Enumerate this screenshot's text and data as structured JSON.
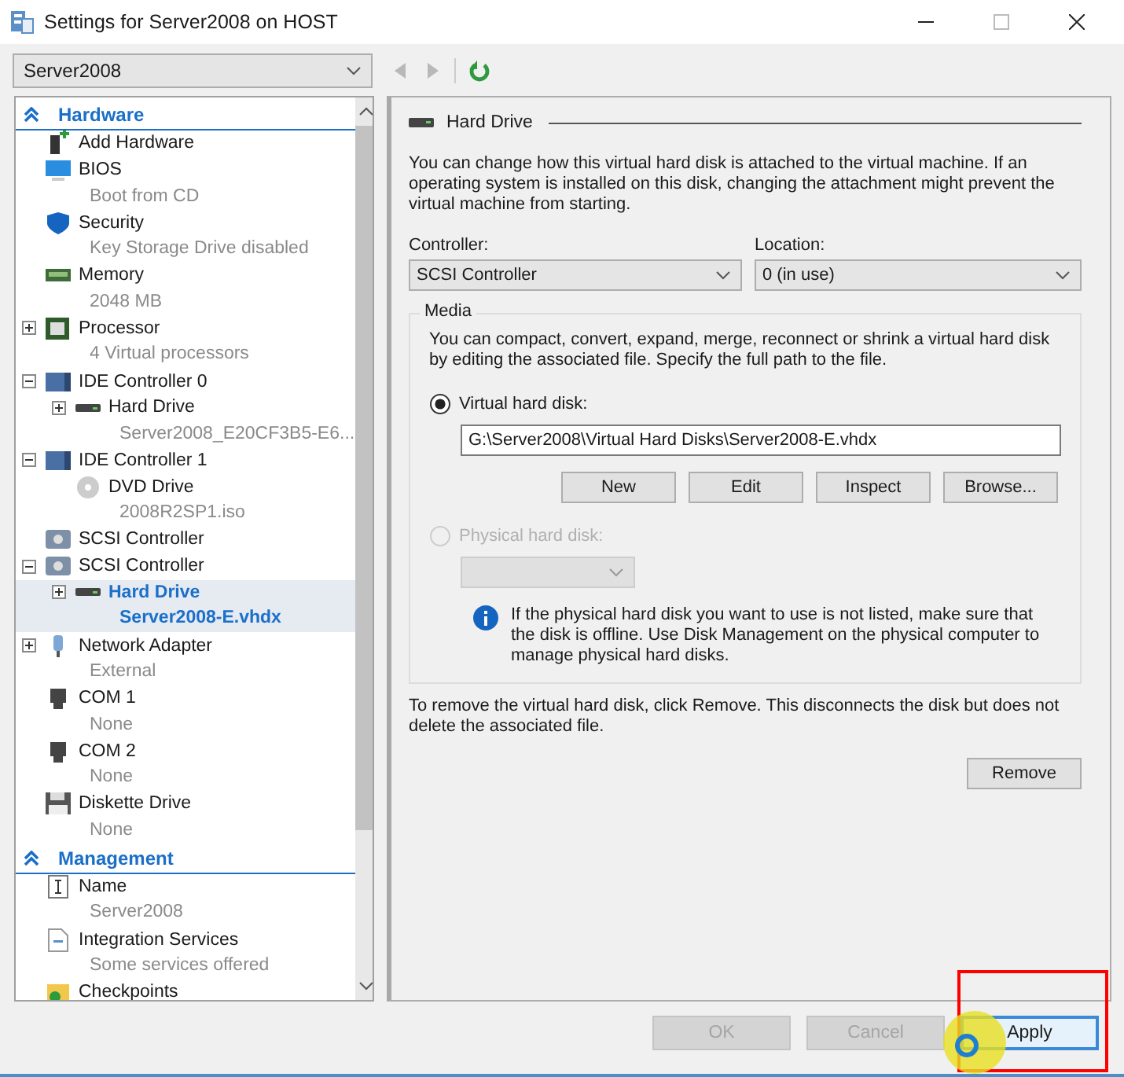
{
  "window": {
    "title": "Settings for Server2008 on HOST"
  },
  "vm_selector": {
    "value": "Server2008"
  },
  "sections": [
    {
      "title": "Hardware",
      "expanded": true,
      "items": [
        {
          "kind": "add-hardware",
          "label": "Add Hardware",
          "selected": false
        },
        {
          "kind": "bios",
          "label": "BIOS",
          "detail": "Boot from CD",
          "selected": false
        },
        {
          "kind": "security",
          "label": "Security",
          "detail": "Key Storage Drive disabled",
          "selected": false
        },
        {
          "kind": "memory",
          "label": "Memory",
          "detail": "2048 MB",
          "selected": false
        },
        {
          "kind": "processor",
          "label": "Processor",
          "detail": "4 Virtual processors",
          "selected": false,
          "expanded": false
        },
        {
          "kind": "ide",
          "label": "IDE Controller 0",
          "selected": false,
          "expanded": true,
          "children": [
            {
              "kind": "hard-drive",
              "label": "Hard Drive",
              "detail": "Server2008_E20CF3B5-E6...",
              "selected": false,
              "expanded": false
            }
          ]
        },
        {
          "kind": "ide",
          "label": "IDE Controller 1",
          "selected": false,
          "expanded": true,
          "children": [
            {
              "kind": "dvd",
              "label": "DVD Drive",
              "detail": "2008R2SP1.iso",
              "selected": false
            }
          ]
        },
        {
          "kind": "scsi",
          "label": "SCSI Controller",
          "selected": false
        },
        {
          "kind": "scsi",
          "label": "SCSI Controller",
          "selected": false,
          "expanded": true,
          "children": [
            {
              "kind": "hard-drive",
              "label": "Hard Drive",
              "detail": "Server2008-E.vhdx",
              "selected": true,
              "expanded": false
            }
          ]
        },
        {
          "kind": "network",
          "label": "Network Adapter",
          "detail": "External",
          "selected": false,
          "expanded": false
        },
        {
          "kind": "com",
          "label": "COM 1",
          "detail": "None",
          "selected": false
        },
        {
          "kind": "com",
          "label": "COM 2",
          "detail": "None",
          "selected": false
        },
        {
          "kind": "diskette",
          "label": "Diskette Drive",
          "detail": "None",
          "selected": false
        }
      ]
    },
    {
      "title": "Management",
      "expanded": true,
      "items": [
        {
          "kind": "name",
          "label": "Name",
          "detail": "Server2008",
          "selected": false
        },
        {
          "kind": "integration",
          "label": "Integration Services",
          "detail": "Some services offered",
          "selected": false
        },
        {
          "kind": "checkpoints",
          "label": "Checkpoints",
          "selected": false
        }
      ]
    }
  ],
  "details": {
    "title": "Hard Drive",
    "intro": "You can change how this virtual hard disk is attached to the virtual machine. If an operating system is installed on this disk, changing the attachment might prevent the virtual machine from starting.",
    "controller": {
      "label": "Controller:",
      "value": "SCSI Controller"
    },
    "location": {
      "label": "Location:",
      "value": "0 (in use)"
    },
    "media": {
      "title": "Media",
      "text": "You can compact, convert, expand, merge, reconnect or shrink a virtual hard disk by editing the associated file. Specify the full path to the file.",
      "options": [
        {
          "kind": "virtual",
          "label": "Virtual hard disk:",
          "selected": true,
          "disabled": false,
          "path": "G:\\Server2008\\Virtual Hard Disks\\Server2008-E.vhdx",
          "buttons": [
            "New",
            "Edit",
            "Inspect",
            "Browse..."
          ]
        },
        {
          "kind": "physical",
          "label": "Physical hard disk:",
          "selected": false,
          "disabled": true,
          "info": "If the physical hard disk you want to use is not listed, make sure that the disk is offline. Use Disk Management on the physical computer to manage physical hard disks."
        }
      ]
    },
    "remove_text": "To remove the virtual hard disk, click Remove. This disconnects the disk but does not delete the associated file.",
    "remove_button": "Remove"
  },
  "buttons": [
    {
      "label": "OK",
      "disabled": true,
      "focused": false
    },
    {
      "label": "Cancel",
      "disabled": true,
      "focused": false
    },
    {
      "label": "Apply",
      "disabled": false,
      "focused": true
    }
  ]
}
